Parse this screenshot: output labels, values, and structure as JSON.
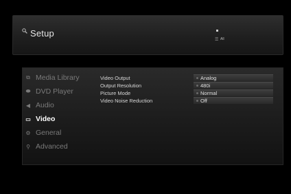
{
  "header": {
    "title": "Setup",
    "icon": "search-icon",
    "filter_label": "All"
  },
  "sidebar": {
    "items": [
      {
        "label": "Media Library",
        "icon": "library-icon",
        "active": false
      },
      {
        "label": "DVD Player",
        "icon": "disc-icon",
        "active": false
      },
      {
        "label": "Audio",
        "icon": "speaker-icon",
        "active": false
      },
      {
        "label": "Video",
        "icon": "screen-icon",
        "active": true
      },
      {
        "label": "General",
        "icon": "gear-icon",
        "active": false
      },
      {
        "label": "Advanced",
        "icon": "search-icon",
        "active": false
      }
    ]
  },
  "settings": [
    {
      "label": "Video Output",
      "value": "Analog"
    },
    {
      "label": "Output Resolution",
      "value": "480i"
    },
    {
      "label": "Picture Mode",
      "value": "Normal"
    },
    {
      "label": "Video Noise Reduction",
      "value": "Off"
    }
  ],
  "colors": {
    "background": "#000000",
    "panel": "#1e1e1e",
    "active_text": "#ffffff",
    "inactive_text": "#7a7a7a"
  }
}
